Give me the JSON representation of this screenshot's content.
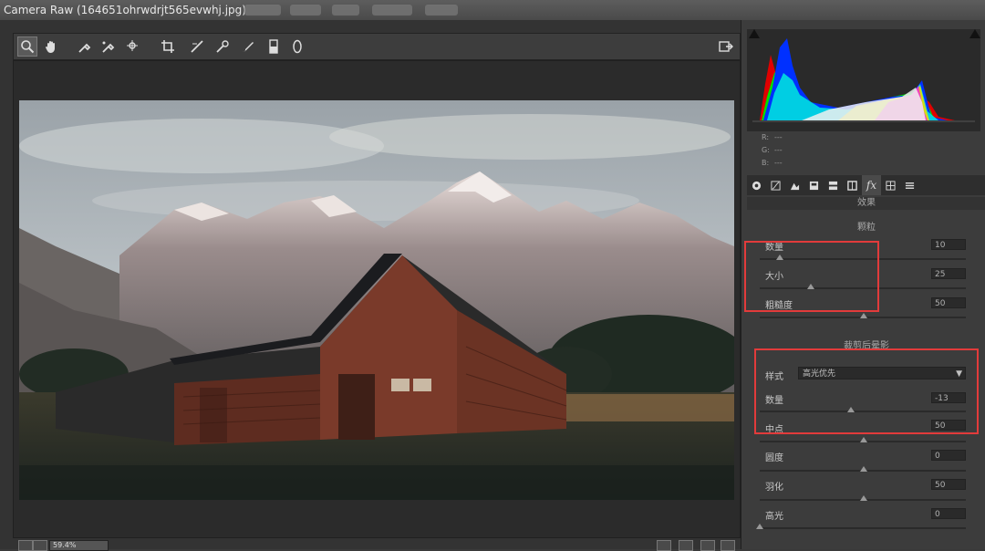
{
  "window": {
    "title": "Camera Raw (164651ohrwdrjt565evwhj.jpg)"
  },
  "toolbar": {
    "tools": [
      "zoom-icon",
      "hand-icon",
      "white-balance-icon",
      "color-sampler-icon",
      "targeted-adjustment-icon",
      "crop-icon",
      "straighten-icon",
      "spot-removal-icon",
      "red-eye-icon",
      "adjustment-brush-icon",
      "graduated-filter-icon",
      "radial-filter-icon"
    ]
  },
  "status": {
    "zoom": "59.4%"
  },
  "histogram": {
    "r_label": "R:",
    "g_label": "G:",
    "b_label": "B:",
    "r_value": "---",
    "g_value": "---",
    "b_value": "---"
  },
  "panel": {
    "section_title": "效果",
    "grain": {
      "title": "颗粒",
      "amount_label": "数量",
      "amount_value": "10",
      "size_label": "大小",
      "size_value": "25",
      "roughness_label": "粗糙度",
      "roughness_value": "50"
    },
    "vignette": {
      "title": "裁剪后晕影",
      "style_label": "样式",
      "style_value": "高光优先",
      "amount_label": "数量",
      "amount_value": "-13",
      "midpoint_label": "中点",
      "midpoint_value": "50",
      "roundness_label": "圆度",
      "roundness_value": "0",
      "feather_label": "羽化",
      "feather_value": "50",
      "highlights_label": "高光",
      "highlights_value": "0"
    }
  },
  "colors": {
    "highlight_box": "#e23b3b"
  }
}
